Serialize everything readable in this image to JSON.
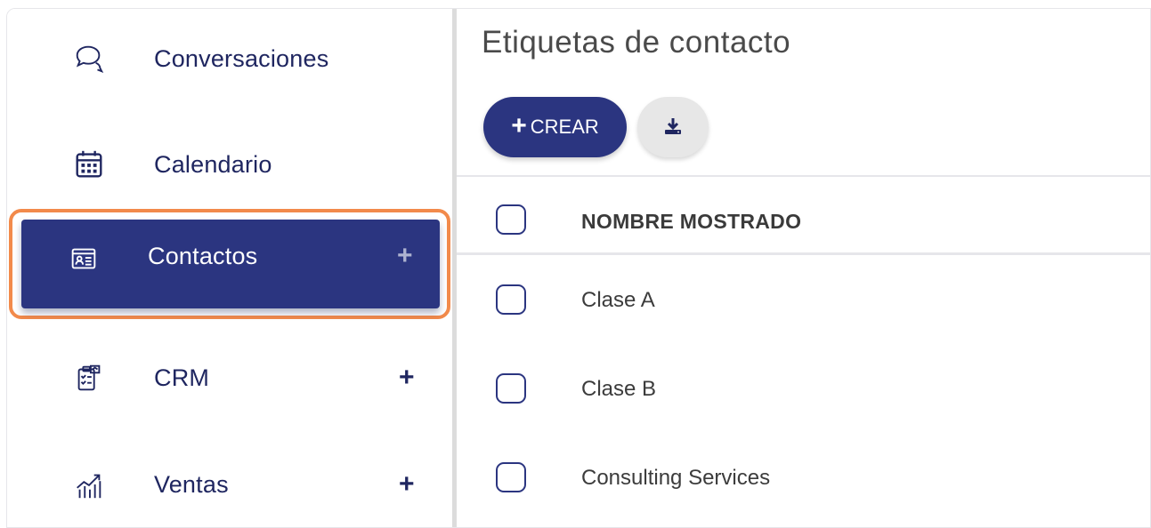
{
  "sidebar": {
    "items": [
      {
        "label": "Conversaciones",
        "icon": "chat-bubbles-icon",
        "plus": ""
      },
      {
        "label": "Calendario",
        "icon": "calendar-icon",
        "plus": ""
      },
      {
        "label": "Contactos",
        "icon": "contact-card-icon",
        "plus": "+"
      },
      {
        "label": "CRM",
        "icon": "crm-handshake-icon",
        "plus": "+"
      },
      {
        "label": "Ventas",
        "icon": "sales-chart-icon",
        "plus": "+"
      }
    ],
    "active_index": 2
  },
  "main": {
    "title": "Etiquetas de contacto",
    "create_button": {
      "plus": "+",
      "label": "CREAR"
    },
    "download_button": {
      "icon": "download-icon"
    },
    "table": {
      "column_header": "NOMBRE MOSTRADO",
      "rows": [
        "Clase A",
        "Clase B",
        "Consulting Services"
      ]
    }
  },
  "colors": {
    "brand": "#2b3580",
    "highlight": "#f28a4b",
    "text": "#1f2660"
  }
}
